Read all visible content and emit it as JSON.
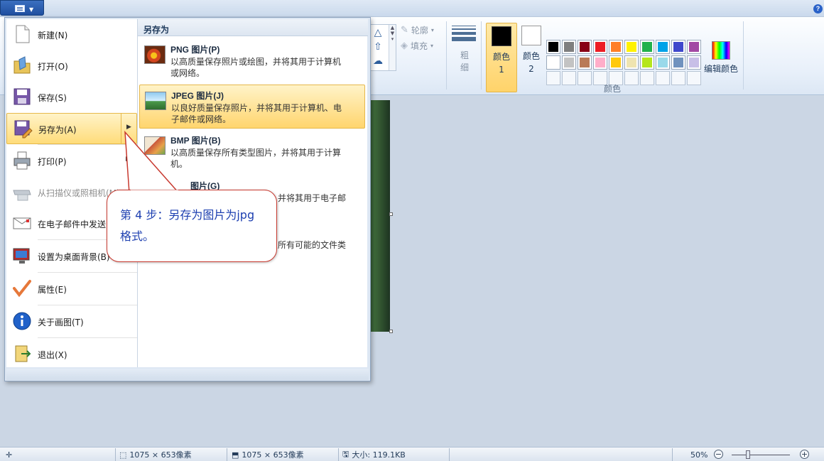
{
  "ribbon": {
    "outline_label": "轮廓",
    "fill_label": "填充",
    "thickness_label": "粗细",
    "color1_label": "颜色 1",
    "color2_label": "颜色 2",
    "edit_colors_label": "编辑颜色",
    "colors_group_label": "颜色",
    "color1_value": "#000000",
    "color2_value": "#ffffff",
    "palette": [
      "#000000",
      "#7f7f7f",
      "#880015",
      "#ed1c24",
      "#ff7f27",
      "#fff200",
      "#22b14c",
      "#00a2e8",
      "#3f48cc",
      "#a349a4",
      "#ffffff",
      "#c3c3c3",
      "#b97a57",
      "#ffaec9",
      "#ffc90e",
      "#efe4b0",
      "#b5e61d",
      "#99d9ea",
      "#7092be",
      "#c8bfe7"
    ]
  },
  "app_menu": {
    "items": [
      {
        "label": "新建(N)",
        "icon": "new-file-icon"
      },
      {
        "label": "打开(O)",
        "icon": "open-folder-icon"
      },
      {
        "label": "保存(S)",
        "icon": "save-disk-icon"
      },
      {
        "label": "另存为(A)",
        "icon": "save-as-icon"
      },
      {
        "label": "打印(P)",
        "icon": "printer-icon"
      },
      {
        "label": "从扫描仪或照相机(M)",
        "icon": "scanner-icon"
      },
      {
        "label": "在电子邮件中发送",
        "icon": "email-icon"
      },
      {
        "label": "设置为桌面背景(B)",
        "icon": "desktop-icon"
      },
      {
        "label": "属性(E)",
        "icon": "checkmark-icon"
      },
      {
        "label": "关于画图(T)",
        "icon": "info-icon"
      },
      {
        "label": "退出(X)",
        "icon": "exit-icon"
      }
    ]
  },
  "save_as_menu": {
    "header": "另存为",
    "items": [
      {
        "title": "PNG 图片(P)",
        "desc": "以高质量保存照片或绘图，并将其用于计算机或网络。"
      },
      {
        "title": "JPEG 图片(J)",
        "desc": "以良好质量保存照片，并将其用于计算机、电子邮件或网络。"
      },
      {
        "title": "BMP 图片(B)",
        "desc": "以高质量保存所有类型图片，并将其用于计算机。"
      },
      {
        "title": "图片(G)",
        "desc": "并将其用于电子邮"
      },
      {
        "title": "",
        "desc": "所有可能的文件类"
      }
    ]
  },
  "callout": {
    "text": "第 4 步：另存为图片为jpg格式。"
  },
  "status_bar": {
    "selection_size": "1075 × 653像素",
    "image_size": "1075 × 653像素",
    "file_size": "大小: 119.1KB",
    "zoom": "50%"
  }
}
